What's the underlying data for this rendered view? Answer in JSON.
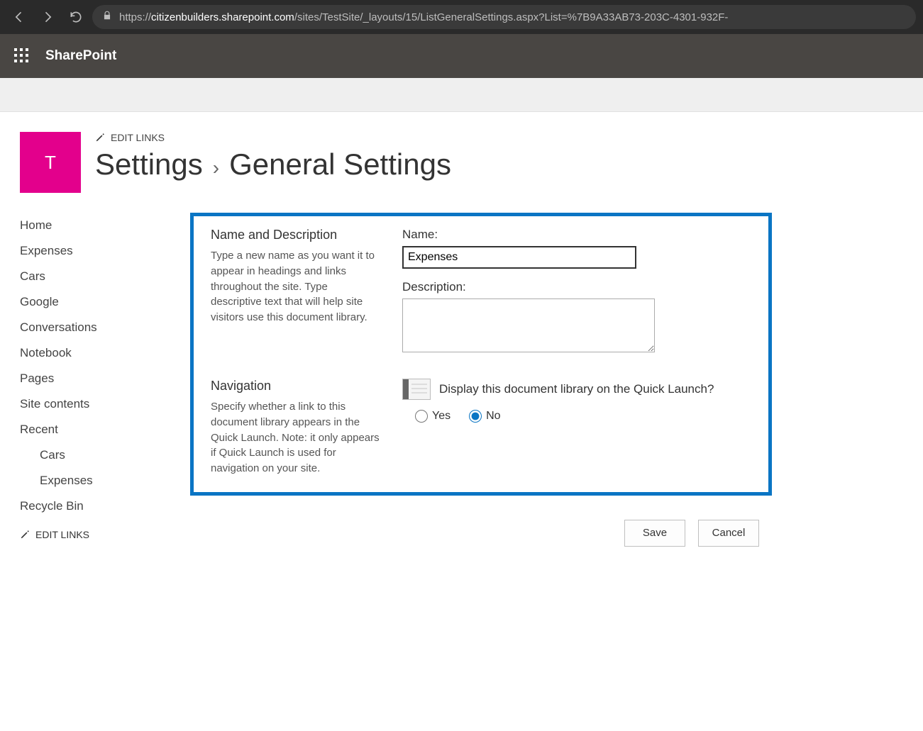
{
  "browser": {
    "url_prefix": "https://",
    "url_domain": "citizenbuilders.sharepoint.com",
    "url_path": "/sites/TestSite/_layouts/15/ListGeneralSettings.aspx?List=%7B9A33AB73-203C-4301-932F-"
  },
  "suite": {
    "title": "SharePoint"
  },
  "header": {
    "edit_links": "EDIT LINKS",
    "logo_letter": "T",
    "breadcrumb_settings": "Settings",
    "breadcrumb_sep": "›",
    "breadcrumb_current": "General Settings"
  },
  "nav": {
    "items": [
      "Home",
      "Expenses",
      "Cars",
      "Google",
      "Conversations",
      "Notebook",
      "Pages",
      "Site contents",
      "Recent"
    ],
    "recent_children": [
      "Cars",
      "Expenses"
    ],
    "recycle": "Recycle Bin",
    "edit_links": "EDIT LINKS"
  },
  "form": {
    "section1": {
      "title": "Name and Description",
      "desc": "Type a new name as you want it to appear in headings and links throughout the site. Type descriptive text that will help site visitors use this document library.",
      "name_label": "Name:",
      "name_value": "Expenses",
      "desc_label": "Description:",
      "desc_value": ""
    },
    "section2": {
      "title": "Navigation",
      "desc": "Specify whether a link to this document library appears in the Quick Launch. Note: it only appears if Quick Launch is used for navigation on your site.",
      "question": "Display this document library on the Quick Launch?",
      "yes": "Yes",
      "no": "No",
      "selected": "no"
    },
    "buttons": {
      "save": "Save",
      "cancel": "Cancel"
    }
  }
}
